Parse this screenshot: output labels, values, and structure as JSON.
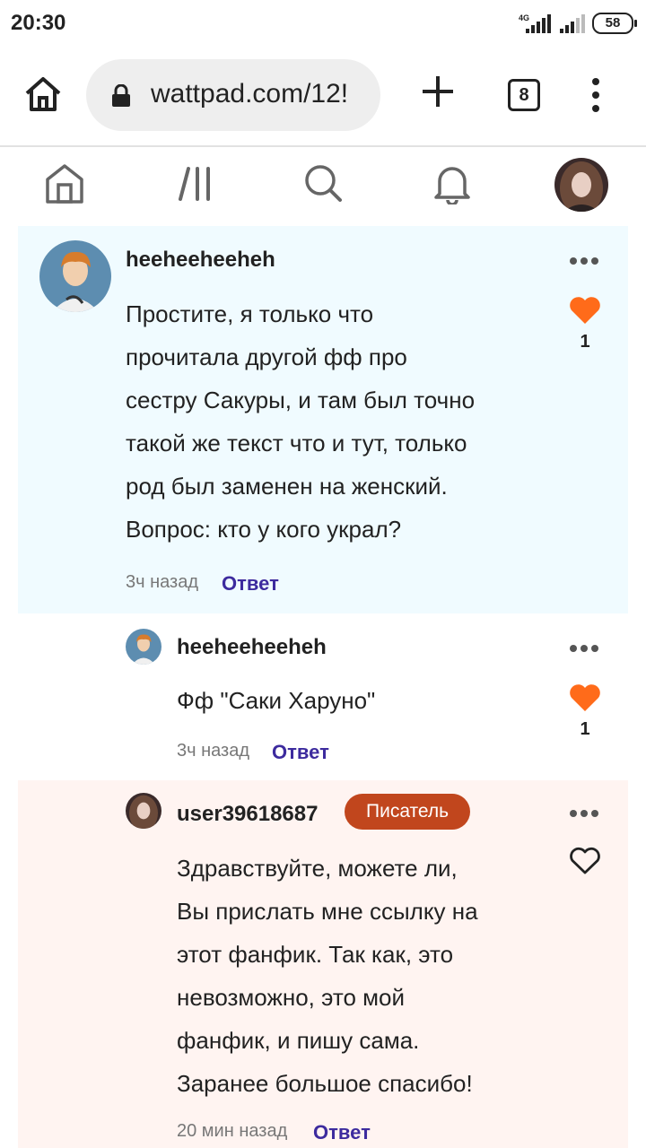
{
  "status_bar": {
    "time": "20:30",
    "network": "4G",
    "battery": "58"
  },
  "browser": {
    "url": "wattpad.com/12!",
    "tab_count": "8"
  },
  "nav": {
    "items": [
      "home-icon",
      "library-icon",
      "search-icon",
      "notifications-icon",
      "profile-avatar"
    ]
  },
  "comments": [
    {
      "username": "heeheeheeheh",
      "text": "Простите, я только что\nпрочитала другой фф про\nсестру Сакуры, и там был точно\nтакой же текст что и тут, только\nрод был заменен на женский.\nВопрос: кто у кого украл?",
      "time": "3ч назад",
      "reply": "Ответ",
      "likes": "1",
      "liked": true
    },
    {
      "username": "heeheeheeheh",
      "text": "Фф \"Саки Харуно\"",
      "time": "3ч назад",
      "reply": "Ответ",
      "likes": "1",
      "liked": true
    },
    {
      "username": "user39618687",
      "badge": "Писатель",
      "text": "Здравствуйте, можете ли,\nВы прислать мне ссылку на\nэтот фанфик. Так как, это\nневозможно, это мой\nфанфик, и пишу сама.\nЗаранее большое спасибо!",
      "time": "20 мин назад",
      "reply": "Ответ",
      "liked": false
    }
  ],
  "colors": {
    "heart": "#ff6b1a",
    "reply": "#3d2b9e",
    "badge": "#c1461d",
    "highlight": "#f0fbff",
    "writer_bg": "#fff4f1"
  }
}
